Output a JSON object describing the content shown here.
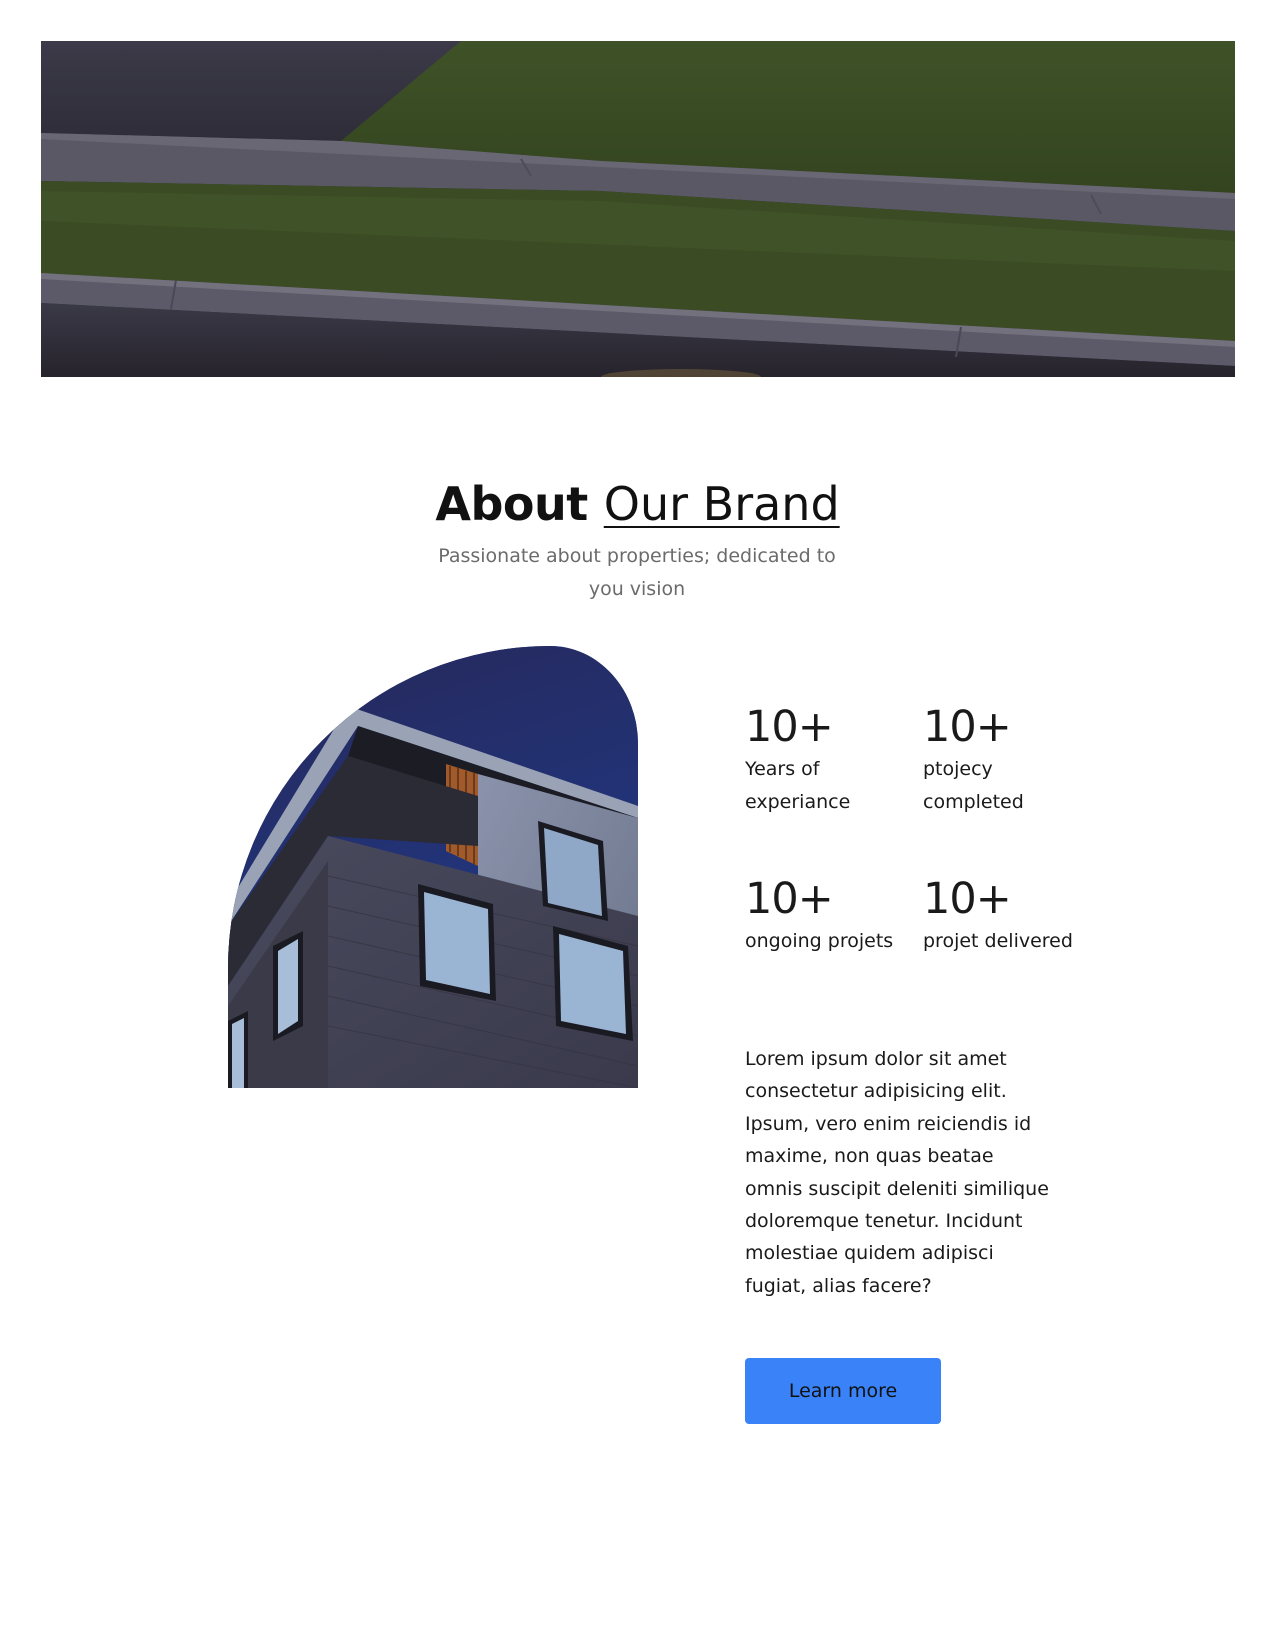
{
  "about": {
    "title_strong": "About",
    "title_light": "Our Brand",
    "subtitle": "Passionate about properties; dedicated to you vision",
    "stats": [
      {
        "number": "10+",
        "label": "Years of experiance"
      },
      {
        "number": "10+",
        "label": "ptojecy completed"
      },
      {
        "number": "10+",
        "label": "ongoing projets"
      },
      {
        "number": "10+",
        "label": "projet delivered"
      }
    ],
    "description": "Lorem ipsum dolor sit amet consectetur adipisicing elit. Ipsum, vero enim reiciendis id maxime, non quas beatae omnis suscipit deleniti similique doloremque tenetur. Incidunt molestiae quidem adipisci fugiat, alias facere?",
    "button_label": "Learn more"
  },
  "colors": {
    "button": "#3a82f7",
    "subtitle": "#6b6b6b",
    "text": "#111111"
  }
}
